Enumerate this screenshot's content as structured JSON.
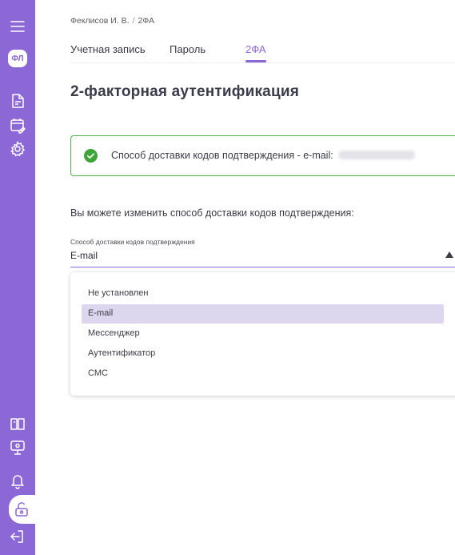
{
  "sidebar": {
    "avatar_initials": "ФЛ",
    "accent_color": "#8c67d6",
    "icons": [
      "menu-icon",
      "document-icon",
      "calendar-edit-icon",
      "gear-icon",
      "book-icon",
      "presentation-icon",
      "bell-icon",
      "unlock-icon",
      "logout-icon"
    ]
  },
  "breadcrumb": {
    "user": "Феклисов И. В.",
    "separator": "/",
    "current": "2ФА"
  },
  "tabs": [
    {
      "label": "Учетная запись"
    },
    {
      "label": "Пароль"
    },
    {
      "label": "2ФА",
      "active": true
    }
  ],
  "page": {
    "title": "2-факторная аутентификация",
    "status_text": "Способ доставки кодов подтверждения - e-mail:",
    "status_color": "#4fb04a",
    "hint": "Вы можете изменить способ доставки кодов подтверждения:"
  },
  "select": {
    "label": "Способ доставки кодов подтверждения",
    "value": "E-mail",
    "options": [
      "Не установлен",
      "E-mail",
      "Мессенджер",
      "Аутентификатор",
      "СМС"
    ],
    "selected_index": 1
  }
}
